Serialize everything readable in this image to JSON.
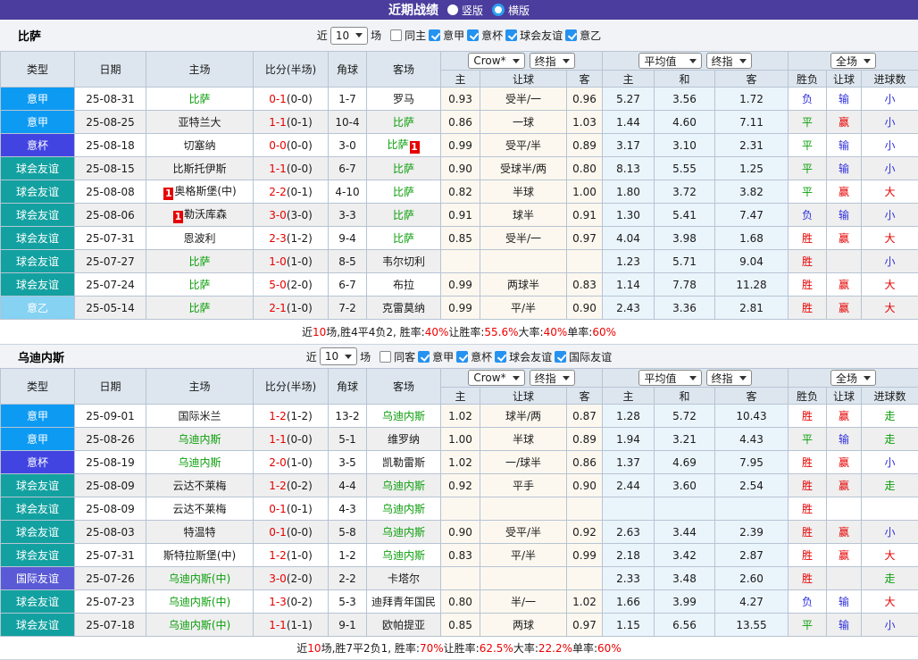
{
  "topbar": {
    "title": "近期战绩",
    "radios": [
      {
        "label": "竖版",
        "selected": false
      },
      {
        "label": "横版",
        "selected": true
      }
    ]
  },
  "table_headers": {
    "main": [
      "类型",
      "日期",
      "主场",
      "比分(半场)",
      "角球",
      "客场"
    ],
    "sub": [
      "主",
      "让球",
      "客",
      "主",
      "和",
      "客",
      "胜负",
      "让球",
      "进球数"
    ],
    "dropdowns": {
      "company": "Crow*",
      "stage1": "终指",
      "average": "平均值",
      "stage2": "终指",
      "scope": "全场"
    }
  },
  "league_colors": {
    "意甲": "#0d9af2",
    "意杯": "#4244e2",
    "球会友谊": "#12a1a0",
    "意乙": "#85d2f2",
    "国际友谊": "#5a5ad6"
  },
  "result_colors": {
    "胜": "#e60000",
    "平": "#0a9e0a",
    "负": "#3030dd",
    "赢": "#e60000",
    "输": "#3030dd",
    "大": "#e60000",
    "小": "#3030dd",
    "走": "#0a9e0a"
  },
  "sections": [
    {
      "team": "比萨",
      "filters": {
        "near_label": "近",
        "count": "10",
        "games_label": "场",
        "same_checked": false,
        "same_label": "同主",
        "leagues": [
          "意甲",
          "意杯",
          "球会友谊",
          "意乙"
        ]
      },
      "rows": [
        {
          "league": "意甲",
          "date": "25-08-31",
          "home": {
            "name": "比萨",
            "focus": true
          },
          "score": {
            "ft": "0-1",
            "ht": "(0-0)"
          },
          "corner": "1-7",
          "away": {
            "name": "罗马",
            "focus": false
          },
          "odds": [
            "0.93",
            "受半/一",
            "0.96"
          ],
          "avg": [
            "5.27",
            "3.56",
            "1.72"
          ],
          "result": [
            "负",
            "输",
            "小"
          ]
        },
        {
          "league": "意甲",
          "date": "25-08-25",
          "home": {
            "name": "亚特兰大",
            "focus": false
          },
          "score": {
            "ft": "1-1",
            "ht": "(0-1)"
          },
          "corner": "10-4",
          "away": {
            "name": "比萨",
            "focus": true
          },
          "odds": [
            "0.86",
            "一球",
            "1.03"
          ],
          "avg": [
            "1.44",
            "4.60",
            "7.11"
          ],
          "result": [
            "平",
            "赢",
            "小"
          ]
        },
        {
          "league": "意杯",
          "date": "25-08-18",
          "home": {
            "name": "切塞纳",
            "focus": false
          },
          "score": {
            "ft": "0-0",
            "ht": "(0-0)"
          },
          "corner": "3-0",
          "away": {
            "name": "比萨",
            "focus": true,
            "badge": "1",
            "badge_pos": "after"
          },
          "odds": [
            "0.99",
            "受平/半",
            "0.89"
          ],
          "avg": [
            "3.17",
            "3.10",
            "2.31"
          ],
          "result": [
            "平",
            "输",
            "小"
          ]
        },
        {
          "league": "球会友谊",
          "date": "25-08-15",
          "home": {
            "name": "比斯托伊斯",
            "focus": false
          },
          "score": {
            "ft": "1-1",
            "ht": "(0-0)"
          },
          "corner": "6-7",
          "away": {
            "name": "比萨",
            "focus": true
          },
          "odds": [
            "0.90",
            "受球半/两",
            "0.80"
          ],
          "avg": [
            "8.13",
            "5.55",
            "1.25"
          ],
          "result": [
            "平",
            "输",
            "小"
          ]
        },
        {
          "league": "球会友谊",
          "date": "25-08-08",
          "home": {
            "name": "奥格斯堡(中)",
            "focus": false,
            "badge": "1",
            "badge_pos": "before"
          },
          "score": {
            "ft": "2-2",
            "ht": "(0-1)"
          },
          "corner": "4-10",
          "away": {
            "name": "比萨",
            "focus": true
          },
          "odds": [
            "0.82",
            "半球",
            "1.00"
          ],
          "avg": [
            "1.80",
            "3.72",
            "3.82"
          ],
          "result": [
            "平",
            "赢",
            "大"
          ]
        },
        {
          "league": "球会友谊",
          "date": "25-08-06",
          "home": {
            "name": "勒沃库森",
            "focus": false,
            "badge": "1",
            "badge_pos": "before"
          },
          "score": {
            "ft": "3-0",
            "ht": "(3-0)"
          },
          "corner": "3-3",
          "away": {
            "name": "比萨",
            "focus": true
          },
          "odds": [
            "0.91",
            "球半",
            "0.91"
          ],
          "avg": [
            "1.30",
            "5.41",
            "7.47"
          ],
          "result": [
            "负",
            "输",
            "小"
          ]
        },
        {
          "league": "球会友谊",
          "date": "25-07-31",
          "home": {
            "name": "恩波利",
            "focus": false
          },
          "score": {
            "ft": "2-3",
            "ht": "(1-2)"
          },
          "corner": "9-4",
          "away": {
            "name": "比萨",
            "focus": true
          },
          "odds": [
            "0.85",
            "受半/一",
            "0.97"
          ],
          "avg": [
            "4.04",
            "3.98",
            "1.68"
          ],
          "result": [
            "胜",
            "赢",
            "大"
          ]
        },
        {
          "league": "球会友谊",
          "date": "25-07-27",
          "home": {
            "name": "比萨",
            "focus": true
          },
          "score": {
            "ft": "1-0",
            "ht": "(1-0)"
          },
          "corner": "8-5",
          "away": {
            "name": "韦尔切利",
            "focus": false
          },
          "odds": [
            "",
            "",
            ""
          ],
          "avg": [
            "1.23",
            "5.71",
            "9.04"
          ],
          "result": [
            "胜",
            "",
            "小"
          ]
        },
        {
          "league": "球会友谊",
          "date": "25-07-24",
          "home": {
            "name": "比萨",
            "focus": true
          },
          "score": {
            "ft": "5-0",
            "ht": "(2-0)"
          },
          "corner": "6-7",
          "away": {
            "name": "布拉",
            "focus": false
          },
          "odds": [
            "0.99",
            "两球半",
            "0.83"
          ],
          "avg": [
            "1.14",
            "7.78",
            "11.28"
          ],
          "result": [
            "胜",
            "赢",
            "大"
          ]
        },
        {
          "league": "意乙",
          "date": "25-05-14",
          "home": {
            "name": "比萨",
            "focus": true
          },
          "score": {
            "ft": "2-1",
            "ht": "(1-0)"
          },
          "corner": "7-2",
          "away": {
            "name": "克雷莫纳",
            "focus": false
          },
          "odds": [
            "0.99",
            "平/半",
            "0.90"
          ],
          "avg": [
            "2.43",
            "3.36",
            "2.81"
          ],
          "result": [
            "胜",
            "赢",
            "大"
          ]
        }
      ],
      "summary": [
        {
          "text": "近"
        },
        {
          "text": "10",
          "red": true
        },
        {
          "text": "场,胜4平4负2, 胜率:"
        },
        {
          "text": "40%",
          "red": true
        },
        {
          "text": " 让胜率:"
        },
        {
          "text": "55.6%",
          "red": true
        },
        {
          "text": " 大率:"
        },
        {
          "text": "40%",
          "red": true
        },
        {
          "text": " 单率:"
        },
        {
          "text": "60%",
          "red": true
        }
      ]
    },
    {
      "team": "乌迪内斯",
      "filters": {
        "near_label": "近",
        "count": "10",
        "games_label": "场",
        "same_checked": false,
        "same_label": "同客",
        "leagues": [
          "意甲",
          "意杯",
          "球会友谊",
          "国际友谊"
        ]
      },
      "rows": [
        {
          "league": "意甲",
          "date": "25-09-01",
          "home": {
            "name": "国际米兰",
            "focus": false
          },
          "score": {
            "ft": "1-2",
            "ht": "(1-2)"
          },
          "corner": "13-2",
          "away": {
            "name": "乌迪内斯",
            "focus": true
          },
          "odds": [
            "1.02",
            "球半/两",
            "0.87"
          ],
          "avg": [
            "1.28",
            "5.72",
            "10.43"
          ],
          "result": [
            "胜",
            "赢",
            "走"
          ]
        },
        {
          "league": "意甲",
          "date": "25-08-26",
          "home": {
            "name": "乌迪内斯",
            "focus": true
          },
          "score": {
            "ft": "1-1",
            "ht": "(0-0)"
          },
          "corner": "5-1",
          "away": {
            "name": "维罗纳",
            "focus": false
          },
          "odds": [
            "1.00",
            "半球",
            "0.89"
          ],
          "avg": [
            "1.94",
            "3.21",
            "4.43"
          ],
          "result": [
            "平",
            "输",
            "走"
          ]
        },
        {
          "league": "意杯",
          "date": "25-08-19",
          "home": {
            "name": "乌迪内斯",
            "focus": true
          },
          "score": {
            "ft": "2-0",
            "ht": "(1-0)"
          },
          "corner": "3-5",
          "away": {
            "name": "凯勒雷斯",
            "focus": false
          },
          "odds": [
            "1.02",
            "一/球半",
            "0.86"
          ],
          "avg": [
            "1.37",
            "4.69",
            "7.95"
          ],
          "result": [
            "胜",
            "赢",
            "小"
          ]
        },
        {
          "league": "球会友谊",
          "date": "25-08-09",
          "home": {
            "name": "云达不莱梅",
            "focus": false
          },
          "score": {
            "ft": "1-2",
            "ht": "(0-2)"
          },
          "corner": "4-4",
          "away": {
            "name": "乌迪内斯",
            "focus": true
          },
          "odds": [
            "0.92",
            "平手",
            "0.90"
          ],
          "avg": [
            "2.44",
            "3.60",
            "2.54"
          ],
          "result": [
            "胜",
            "赢",
            "走"
          ]
        },
        {
          "league": "球会友谊",
          "date": "25-08-09",
          "home": {
            "name": "云达不莱梅",
            "focus": false
          },
          "score": {
            "ft": "0-1",
            "ht": "(0-1)"
          },
          "corner": "4-3",
          "away": {
            "name": "乌迪内斯",
            "focus": true
          },
          "odds": [
            "",
            "",
            ""
          ],
          "avg": [
            "",
            "",
            ""
          ],
          "result": [
            "胜",
            "",
            ""
          ]
        },
        {
          "league": "球会友谊",
          "date": "25-08-03",
          "home": {
            "name": "特温特",
            "focus": false
          },
          "score": {
            "ft": "0-1",
            "ht": "(0-0)"
          },
          "corner": "5-8",
          "away": {
            "name": "乌迪内斯",
            "focus": true
          },
          "odds": [
            "0.90",
            "受平/半",
            "0.92"
          ],
          "avg": [
            "2.63",
            "3.44",
            "2.39"
          ],
          "result": [
            "胜",
            "赢",
            "小"
          ]
        },
        {
          "league": "球会友谊",
          "date": "25-07-31",
          "home": {
            "name": "斯特拉斯堡(中)",
            "focus": false
          },
          "score": {
            "ft": "1-2",
            "ht": "(1-0)"
          },
          "corner": "1-2",
          "away": {
            "name": "乌迪内斯",
            "focus": true
          },
          "odds": [
            "0.83",
            "平/半",
            "0.99"
          ],
          "avg": [
            "2.18",
            "3.42",
            "2.87"
          ],
          "result": [
            "胜",
            "赢",
            "大"
          ]
        },
        {
          "league": "国际友谊",
          "date": "25-07-26",
          "home": {
            "name": "乌迪内斯(中)",
            "focus": true
          },
          "score": {
            "ft": "3-0",
            "ht": "(2-0)"
          },
          "corner": "2-2",
          "away": {
            "name": "卡塔尔",
            "focus": false
          },
          "odds": [
            "",
            "",
            ""
          ],
          "avg": [
            "2.33",
            "3.48",
            "2.60"
          ],
          "result": [
            "胜",
            "",
            "走"
          ]
        },
        {
          "league": "球会友谊",
          "date": "25-07-23",
          "home": {
            "name": "乌迪内斯(中)",
            "focus": true
          },
          "score": {
            "ft": "1-3",
            "ht": "(0-2)"
          },
          "corner": "5-3",
          "away": {
            "name": "迪拜青年国民",
            "focus": false
          },
          "odds": [
            "0.80",
            "半/一",
            "1.02"
          ],
          "avg": [
            "1.66",
            "3.99",
            "4.27"
          ],
          "result": [
            "负",
            "输",
            "大"
          ]
        },
        {
          "league": "球会友谊",
          "date": "25-07-18",
          "home": {
            "name": "乌迪内斯(中)",
            "focus": true
          },
          "score": {
            "ft": "1-1",
            "ht": "(1-1)"
          },
          "corner": "9-1",
          "away": {
            "name": "欧帕提亚",
            "focus": false
          },
          "odds": [
            "0.85",
            "两球",
            "0.97"
          ],
          "avg": [
            "1.15",
            "6.56",
            "13.55"
          ],
          "result": [
            "平",
            "输",
            "小"
          ]
        }
      ],
      "summary": [
        {
          "text": "近"
        },
        {
          "text": "10",
          "red": true
        },
        {
          "text": "场,胜7平2负1, 胜率:"
        },
        {
          "text": "70%",
          "red": true
        },
        {
          "text": " 让胜率:"
        },
        {
          "text": "62.5%",
          "red": true
        },
        {
          "text": " 大率:"
        },
        {
          "text": "22.2%",
          "red": true
        },
        {
          "text": " 单率:"
        },
        {
          "text": "60%",
          "red": true
        }
      ]
    }
  ]
}
